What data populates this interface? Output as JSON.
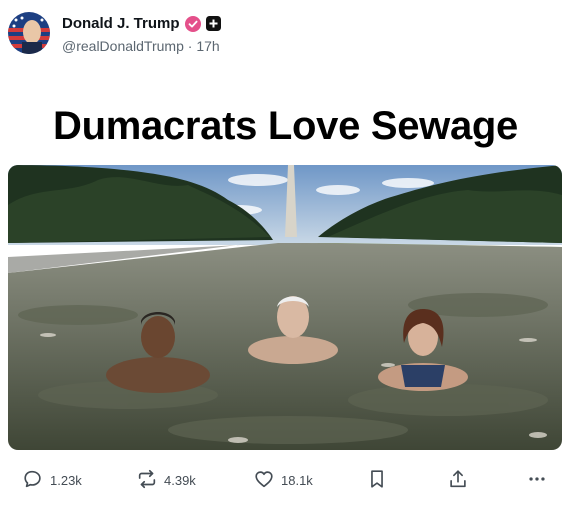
{
  "post": {
    "author_name": "Donald J. Trump",
    "handle": "@realDonaldTrump",
    "separator": "·",
    "time": "17h",
    "headline": "Dumacrats Love Sewage"
  },
  "media": {
    "icon": "photo-image"
  },
  "actions": {
    "replies": "1.23k",
    "reposts": "4.39k",
    "likes": "18.1k"
  },
  "colors": {
    "verified_badge": "#e4508a",
    "text_secondary": "#5b6670",
    "sky": "#7fa6cf"
  }
}
